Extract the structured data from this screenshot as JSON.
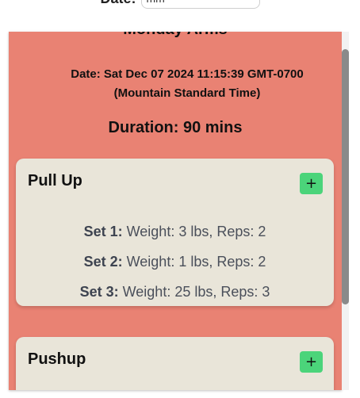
{
  "filter": {
    "date_label": "Date:",
    "date_value": "mm"
  },
  "workout": {
    "title": "Monday Arms",
    "date_line1": "Date: Sat Dec 07 2024 11:15:39 GMT-0700",
    "date_line2": "(Mountain Standard Time)",
    "duration": "Duration: 90 mins"
  },
  "exercises": [
    {
      "name": "Pull Up",
      "add_label": "+",
      "sets": [
        {
          "label": "Set 1:",
          "detail": " Weight: 3 lbs, Reps: 2"
        },
        {
          "label": "Set 2:",
          "detail": " Weight: 1 lbs, Reps: 2"
        },
        {
          "label": "Set 3:",
          "detail": " Weight: 25 lbs, Reps: 3"
        }
      ]
    },
    {
      "name": "Pushup",
      "add_label": "+",
      "sets": []
    }
  ],
  "colors": {
    "panel_bg": "#e98273",
    "card_bg": "#e9e5d9",
    "add_button": "#4bd47a"
  },
  "icons": {
    "add": "plus-icon"
  }
}
